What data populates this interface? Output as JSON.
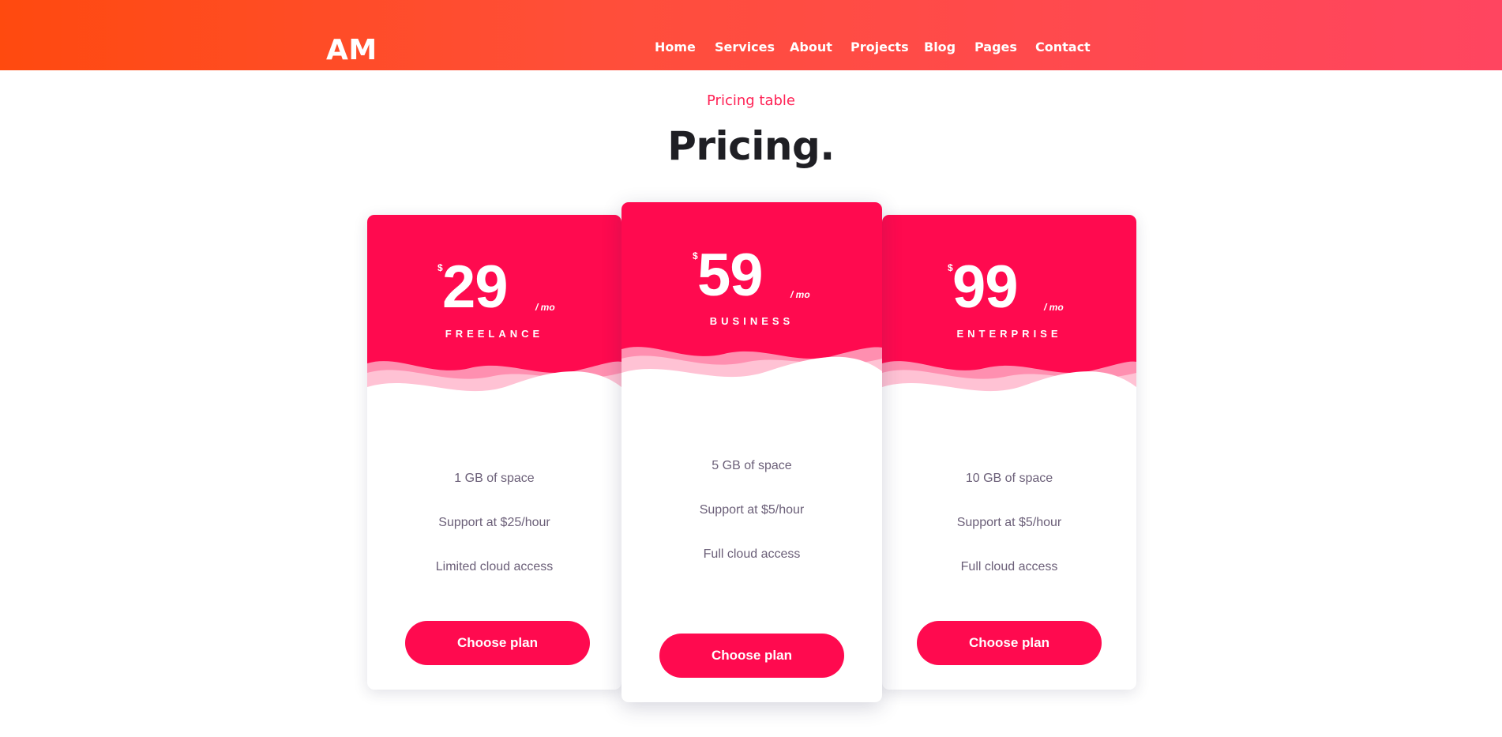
{
  "brand": "AM",
  "nav": {
    "items": [
      "Home",
      "Services",
      "About",
      "Projects",
      "Blog",
      "Pages",
      "Contact"
    ]
  },
  "section": {
    "subtitle": "Pricing table",
    "title": "Pricing."
  },
  "plans": [
    {
      "currency": "$",
      "price": "29",
      "period": "/ mo",
      "name": "FREELANCE",
      "features": [
        "1 GB of space",
        "Support at $25/hour",
        "Limited cloud access"
      ],
      "button": "Choose plan"
    },
    {
      "currency": "$",
      "price": "59",
      "period": "/ mo",
      "name": "BUSINESS",
      "features": [
        "5 GB of space",
        "Support at $5/hour",
        "Full cloud access"
      ],
      "button": "Choose plan"
    },
    {
      "currency": "$",
      "price": "99",
      "period": "/ mo",
      "name": "ENTERPRISE",
      "features": [
        "10 GB of space",
        "Support at $5/hour",
        "Full cloud access"
      ],
      "button": "Choose plan"
    }
  ],
  "colors": {
    "accent": "#ff0a4f",
    "nav_gradient_start": "#ff4a0f",
    "nav_gradient_end": "#ff4560",
    "feature_text": "#6b5f78",
    "title_text": "#1f1f24"
  }
}
